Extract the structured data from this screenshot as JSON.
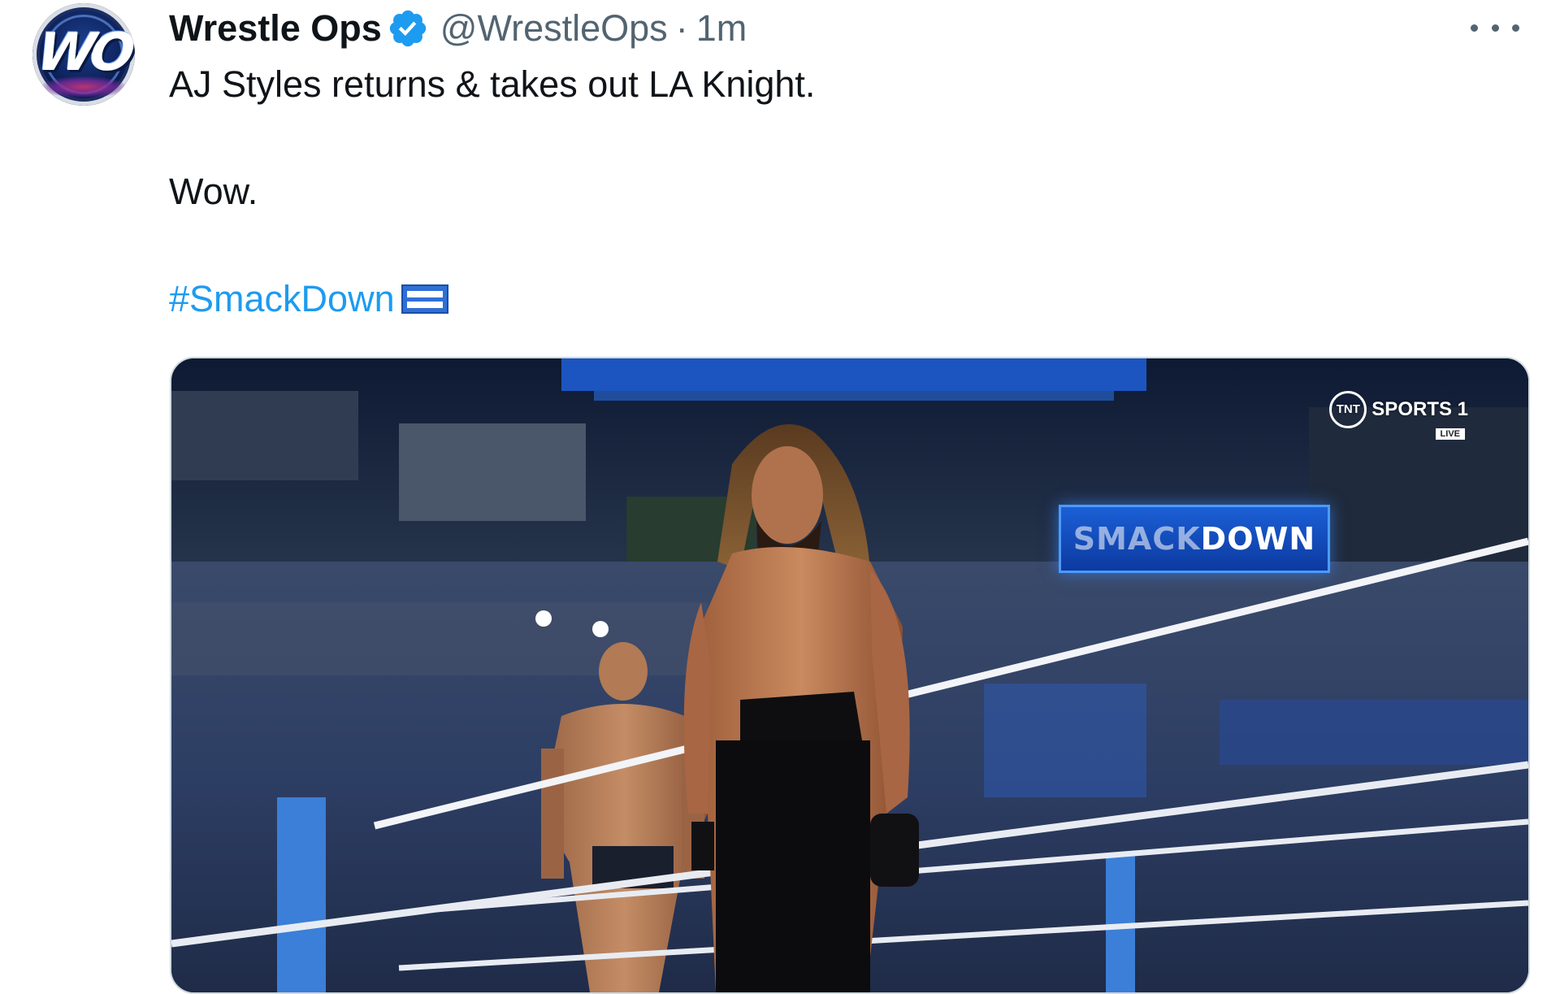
{
  "tweet": {
    "author_name": "Wrestle Ops",
    "avatar_text": "WO",
    "handle": "@WrestleOps",
    "separator": "·",
    "time": "1m",
    "line1": "AJ Styles returns & takes out LA Knight.",
    "line2": "Wow.",
    "hashtag": "#SmackDown"
  },
  "media": {
    "broadcaster_logo": "TNT",
    "broadcaster_text": "SPORTS 1",
    "live_badge": "LIVE",
    "arena_sign_part1": "SMACK",
    "arena_sign_part2": "DOWN"
  },
  "icons": {
    "verified": "verified-badge-icon",
    "more": "more-options-icon",
    "hashflag": "smackdown-hashflag-icon"
  },
  "colors": {
    "accent": "#1d9bf0",
    "secondary_text": "#536471",
    "primary_text": "#0f1419"
  }
}
